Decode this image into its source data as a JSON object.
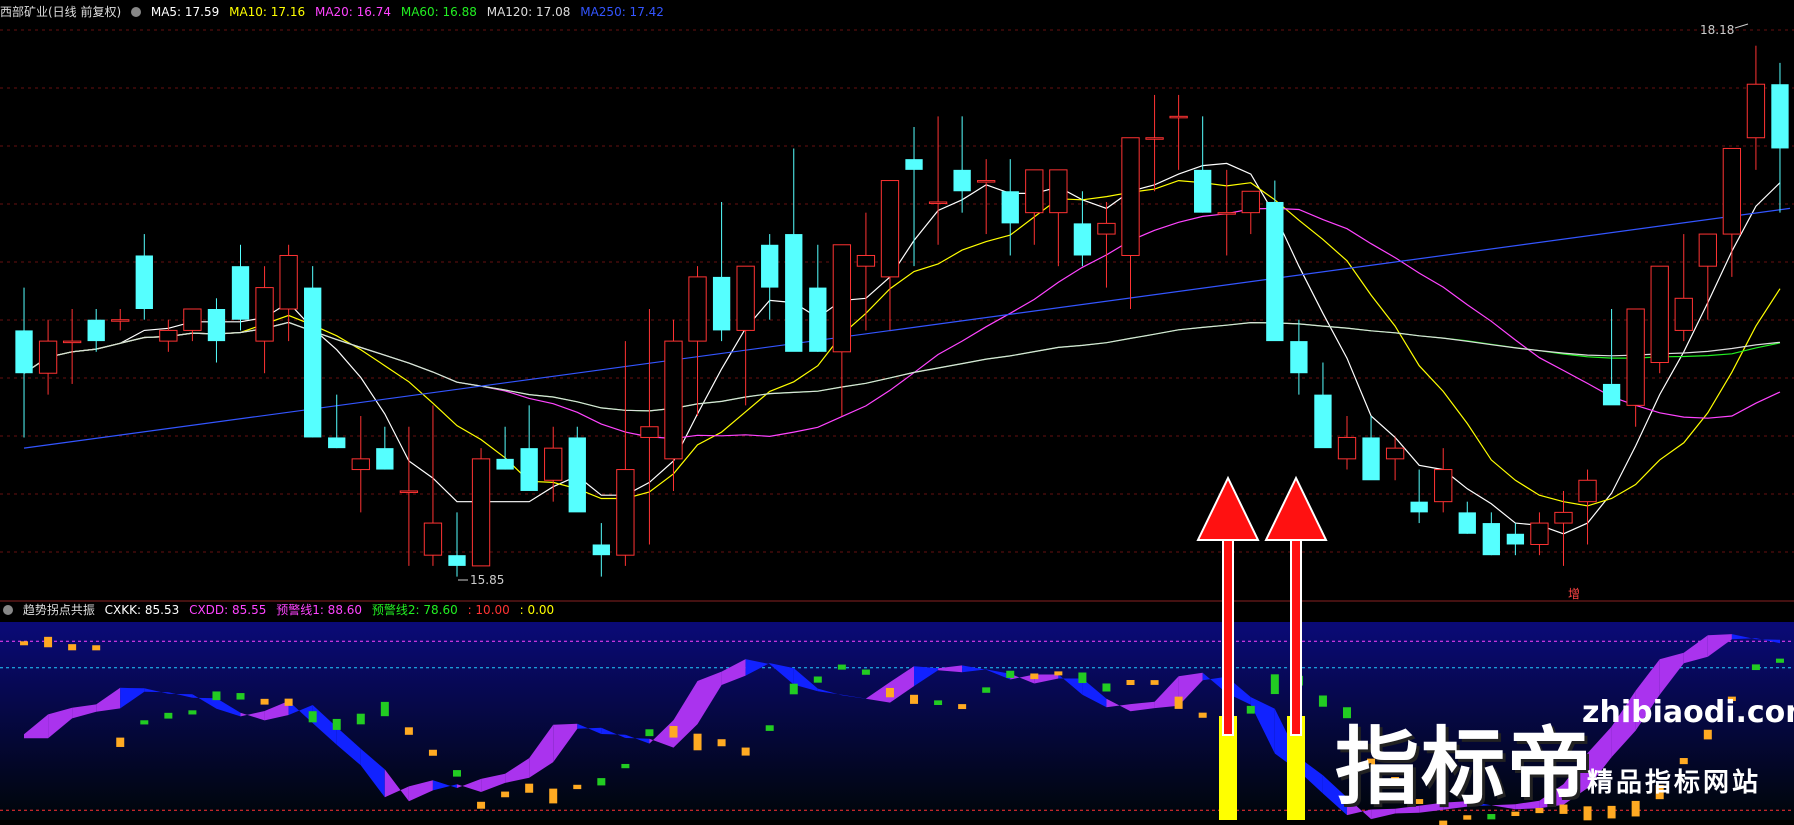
{
  "header": {
    "title": "西部矿业(日线 前复权)",
    "ma": [
      {
        "label": "MA5: 17.59",
        "color": "#ffffff"
      },
      {
        "label": "MA10: 17.16",
        "color": "#ffff00"
      },
      {
        "label": "MA20: 16.74",
        "color": "#ff44ff"
      },
      {
        "label": "MA60: 16.88",
        "color": "#22ee22"
      },
      {
        "label": "MA120: 17.08",
        "color": "#dddddd"
      },
      {
        "label": "MA250: 17.42",
        "color": "#3355ff"
      }
    ]
  },
  "sub_header": {
    "title": "趋势拐点共振",
    "items": [
      {
        "label": "CXKK: 85.53",
        "color": "#ffffff"
      },
      {
        "label": "CXDD: 85.55",
        "color": "#ff44ff"
      },
      {
        "label": "预警线1: 88.60",
        "color": "#ff44ff"
      },
      {
        "label": "预警线2: 78.60",
        "color": "#22ee22"
      },
      {
        "label": ": 10.00",
        "color": "#ff3333"
      },
      {
        "label": ": 0.00",
        "color": "#ffff00"
      }
    ]
  },
  "price_labels": {
    "high": "18.18",
    "low": "15.85",
    "signal": "增"
  },
  "watermark": {
    "main": "指标帝",
    "domain": "zhibiaodi.com",
    "sub": "精品指标网站"
  },
  "colors": {
    "up": "#ff3333",
    "down": "#55ffff",
    "ma5": "#ffffff",
    "ma10": "#ffff00",
    "ma20": "#ff44ff",
    "ma60": "#22ee22",
    "ma120": "#dddddd",
    "ma250": "#3355ff"
  },
  "chart_data": [
    {
      "type": "candlestick",
      "ylim": [
        15.6,
        18.3
      ],
      "ohlc": [
        [
          16.85,
          17.05,
          16.35,
          16.65
        ],
        [
          16.65,
          16.9,
          16.55,
          16.8
        ],
        [
          16.8,
          16.95,
          16.6,
          16.8
        ],
        [
          16.9,
          16.95,
          16.75,
          16.8
        ],
        [
          16.9,
          16.95,
          16.85,
          16.9
        ],
        [
          17.2,
          17.3,
          16.9,
          16.95
        ],
        [
          16.8,
          16.9,
          16.75,
          16.85
        ],
        [
          16.85,
          16.95,
          16.8,
          16.95
        ],
        [
          16.95,
          17.0,
          16.7,
          16.8
        ],
        [
          17.15,
          17.25,
          16.85,
          16.9
        ],
        [
          16.8,
          17.15,
          16.65,
          17.05
        ],
        [
          16.95,
          17.25,
          16.8,
          17.2
        ],
        [
          17.05,
          17.15,
          16.35,
          16.35
        ],
        [
          16.35,
          16.55,
          16.3,
          16.3
        ],
        [
          16.2,
          16.45,
          16.0,
          16.25
        ],
        [
          16.3,
          16.4,
          16.2,
          16.2
        ],
        [
          16.1,
          16.4,
          15.75,
          16.1
        ],
        [
          15.8,
          16.5,
          15.75,
          15.95
        ],
        [
          15.8,
          16.0,
          15.7,
          15.75
        ],
        [
          15.75,
          16.3,
          15.75,
          16.25
        ],
        [
          16.25,
          16.4,
          16.2,
          16.2
        ],
        [
          16.3,
          16.5,
          16.2,
          16.1
        ],
        [
          16.15,
          16.4,
          16.05,
          16.3
        ],
        [
          16.35,
          16.4,
          16.1,
          16.0
        ],
        [
          15.85,
          15.95,
          15.7,
          15.8
        ],
        [
          15.8,
          16.8,
          15.75,
          16.2
        ],
        [
          16.35,
          16.95,
          15.85,
          16.4
        ],
        [
          16.25,
          16.9,
          16.1,
          16.8
        ],
        [
          16.8,
          17.15,
          16.45,
          17.1
        ],
        [
          17.1,
          17.45,
          16.8,
          16.85
        ],
        [
          16.85,
          17.15,
          16.5,
          17.15
        ],
        [
          17.25,
          17.3,
          16.9,
          17.05
        ],
        [
          17.3,
          17.7,
          17.0,
          16.75
        ],
        [
          17.05,
          17.25,
          16.75,
          16.75
        ],
        [
          16.75,
          16.9,
          16.45,
          17.25
        ],
        [
          17.15,
          17.4,
          16.85,
          17.2
        ],
        [
          17.1,
          17.45,
          16.85,
          17.55
        ],
        [
          17.65,
          17.8,
          17.15,
          17.6
        ],
        [
          17.45,
          17.85,
          17.25,
          17.45
        ],
        [
          17.6,
          17.85,
          17.4,
          17.5
        ],
        [
          17.55,
          17.65,
          17.3,
          17.55
        ],
        [
          17.5,
          17.65,
          17.2,
          17.35
        ],
        [
          17.4,
          17.45,
          17.25,
          17.6
        ],
        [
          17.4,
          17.45,
          17.15,
          17.6
        ],
        [
          17.35,
          17.5,
          17.15,
          17.2
        ],
        [
          17.3,
          17.45,
          17.05,
          17.35
        ],
        [
          17.2,
          17.45,
          16.95,
          17.75
        ],
        [
          17.75,
          17.95,
          17.5,
          17.75
        ],
        [
          17.85,
          17.95,
          17.6,
          17.85
        ],
        [
          17.6,
          17.85,
          17.4,
          17.4
        ],
        [
          17.4,
          17.6,
          17.2,
          17.4
        ],
        [
          17.4,
          17.5,
          17.3,
          17.5
        ],
        [
          17.45,
          17.55,
          17.2,
          16.8
        ],
        [
          16.8,
          16.9,
          16.55,
          16.65
        ],
        [
          16.55,
          16.7,
          16.35,
          16.3
        ],
        [
          16.25,
          16.45,
          16.2,
          16.35
        ],
        [
          16.35,
          16.45,
          16.2,
          16.15
        ],
        [
          16.25,
          16.35,
          16.15,
          16.3
        ],
        [
          16.05,
          16.2,
          15.95,
          16.0
        ],
        [
          16.05,
          16.3,
          16.0,
          16.2
        ],
        [
          16.0,
          16.05,
          15.9,
          15.9
        ],
        [
          15.95,
          16.0,
          15.8,
          15.8
        ],
        [
          15.9,
          15.95,
          15.8,
          15.85
        ],
        [
          15.85,
          16.0,
          15.8,
          15.95
        ],
        [
          15.95,
          16.1,
          15.75,
          16.0
        ],
        [
          16.05,
          16.2,
          15.85,
          16.15
        ],
        [
          16.6,
          16.95,
          16.6,
          16.5
        ],
        [
          16.5,
          16.9,
          16.4,
          16.95
        ],
        [
          16.7,
          17.1,
          16.65,
          17.15
        ],
        [
          16.85,
          17.3,
          16.8,
          17.0
        ],
        [
          17.15,
          17.3,
          16.9,
          17.3
        ],
        [
          17.3,
          17.65,
          17.1,
          17.7
        ],
        [
          17.75,
          18.18,
          17.6,
          18.0
        ],
        [
          18.0,
          18.1,
          17.4,
          17.7
        ]
      ]
    },
    {
      "type": "oscillator",
      "ylim": [
        0,
        100
      ],
      "warning_line_1": 88.6,
      "warning_line_2": 78.6,
      "cxkk_last": 85.53,
      "cxdd_last": 85.55
    }
  ]
}
